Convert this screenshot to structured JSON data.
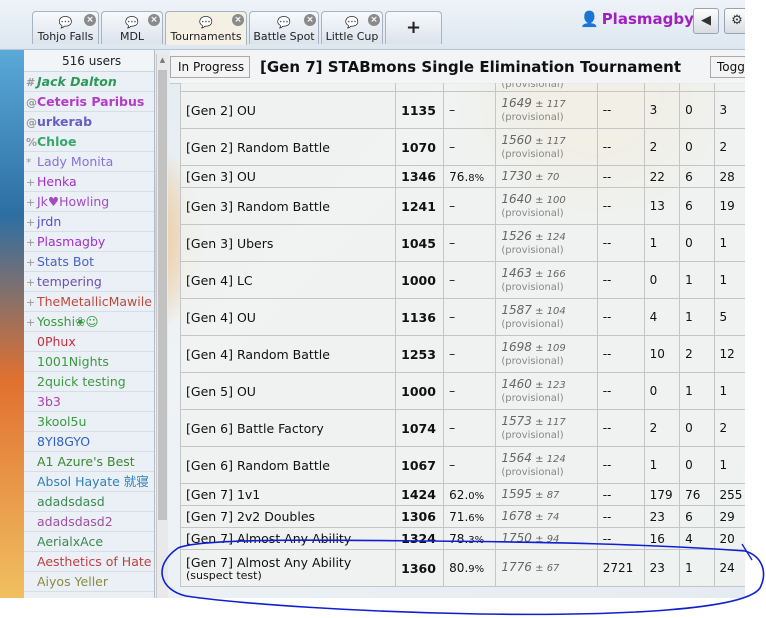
{
  "tabs": [
    {
      "label": "Tohjo Falls",
      "icon": "chat-bubbles-icon"
    },
    {
      "label": "MDL",
      "icon": "chat-bubble-icon"
    },
    {
      "label": "Tournaments",
      "icon": "chat-bubbles-icon"
    },
    {
      "label": "Battle Spot",
      "icon": "chat-bubble-icon"
    },
    {
      "label": "Little Cup",
      "icon": "chat-bubbles-icon"
    }
  ],
  "new_tab_label": "+",
  "user": {
    "name": "Plasmagby",
    "icon": "user-icon"
  },
  "header_buttons": {
    "sound": "speaker-icon",
    "settings": "gear-icon"
  },
  "userlist": {
    "count_label": "516 users",
    "users": [
      {
        "rank": "#",
        "name": "Jack Dalton",
        "color": "#2a9a55",
        "style": "bold italic"
      },
      {
        "rank": "@",
        "name": "Ceteris Paribus",
        "color": "#b23cc8",
        "style": "bold"
      },
      {
        "rank": "@",
        "name": "urkerab",
        "color": "#6b5cc4",
        "style": "bold"
      },
      {
        "rank": "%",
        "name": "Chloe",
        "color": "#36a86a",
        "style": "bold"
      },
      {
        "rank": "*",
        "name": "Lady Monita",
        "color": "#8a6fd8",
        "style": ""
      },
      {
        "rank": "+",
        "name": "Henka",
        "color": "#a230c8",
        "style": ""
      },
      {
        "rank": "+",
        "name": "Jk♥Howling",
        "color": "#a34cc0",
        "style": ""
      },
      {
        "rank": "+",
        "name": "jrdn",
        "color": "#5a4cc8",
        "style": ""
      },
      {
        "rank": "+",
        "name": "Plasmagby",
        "color": "#a230c8",
        "style": ""
      },
      {
        "rank": "+",
        "name": "Stats Bot",
        "color": "#4a62c8",
        "style": ""
      },
      {
        "rank": "+",
        "name": "tempering",
        "color": "#6a50b0",
        "style": ""
      },
      {
        "rank": "+",
        "name": "TheMetallicMawile",
        "color": "#c04a3a",
        "style": ""
      },
      {
        "rank": "+",
        "name": "Yosshi❀☺",
        "color": "#3a9a40",
        "style": ""
      },
      {
        "rank": "",
        "name": "0Phux",
        "color": "#c03040",
        "style": ""
      },
      {
        "rank": "",
        "name": "1001Nights",
        "color": "#3a9a40",
        "style": ""
      },
      {
        "rank": "",
        "name": "2quick testing",
        "color": "#3a9a40",
        "style": ""
      },
      {
        "rank": "",
        "name": "3b3",
        "color": "#b040b0",
        "style": ""
      },
      {
        "rank": "",
        "name": "3kool5u",
        "color": "#3a9a40",
        "style": ""
      },
      {
        "rank": "",
        "name": "8YI8GYO",
        "color": "#3060c8",
        "style": ""
      },
      {
        "rank": "",
        "name": "A1 Azure's Best",
        "color": "#3a8a30",
        "style": ""
      },
      {
        "rank": "",
        "name": "Absol Hayate 就寝",
        "color": "#3080b8",
        "style": ""
      },
      {
        "rank": "",
        "name": "adadsdasd",
        "color": "#3a8a50",
        "style": ""
      },
      {
        "rank": "",
        "name": "adadsdasd2",
        "color": "#a050a0",
        "style": ""
      },
      {
        "rank": "",
        "name": "AerialxAce",
        "color": "#3a8a50",
        "style": ""
      },
      {
        "rank": "",
        "name": "Aesthetics of Hate",
        "color": "#c04040",
        "style": ""
      },
      {
        "rank": "",
        "name": "Aiyos Yeller",
        "color": "#8a8a40",
        "style": ""
      }
    ]
  },
  "main": {
    "in_progress_label": "In Progress",
    "title": "[Gen 7] STABmons Single Elimination Tournament",
    "toggle_label": "Toggle"
  },
  "ladder": {
    "rows": [
      {
        "format": "[Gen 2] OU",
        "format_sub": "",
        "elo": "1135",
        "gxe": "–",
        "gxe_dec": "",
        "glicko": "1649",
        "glicko_dev": "117",
        "provisional": "(provisional)",
        "coil": "--",
        "w": "3",
        "l": "0",
        "t": "3"
      },
      {
        "format": "[Gen 2] Random Battle",
        "format_sub": "",
        "elo": "1070",
        "gxe": "–",
        "gxe_dec": "",
        "glicko": "1560",
        "glicko_dev": "117",
        "provisional": "(provisional)",
        "coil": "--",
        "w": "2",
        "l": "0",
        "t": "2"
      },
      {
        "format": "[Gen 3] OU",
        "format_sub": "",
        "elo": "1346",
        "gxe": "76.",
        "gxe_dec": "8%",
        "glicko": "1730",
        "glicko_dev": "70",
        "provisional": "",
        "coil": "--",
        "w": "22",
        "l": "6",
        "t": "28"
      },
      {
        "format": "[Gen 3] Random Battle",
        "format_sub": "",
        "elo": "1241",
        "gxe": "–",
        "gxe_dec": "",
        "glicko": "1640",
        "glicko_dev": "100",
        "provisional": "(provisional)",
        "coil": "--",
        "w": "13",
        "l": "6",
        "t": "19"
      },
      {
        "format": "[Gen 3] Ubers",
        "format_sub": "",
        "elo": "1045",
        "gxe": "–",
        "gxe_dec": "",
        "glicko": "1526",
        "glicko_dev": "124",
        "provisional": "(provisional)",
        "coil": "--",
        "w": "1",
        "l": "0",
        "t": "1"
      },
      {
        "format": "[Gen 4] LC",
        "format_sub": "",
        "elo": "1000",
        "gxe": "–",
        "gxe_dec": "",
        "glicko": "1463",
        "glicko_dev": "166",
        "provisional": "(provisional)",
        "coil": "--",
        "w": "0",
        "l": "1",
        "t": "1"
      },
      {
        "format": "[Gen 4] OU",
        "format_sub": "",
        "elo": "1136",
        "gxe": "–",
        "gxe_dec": "",
        "glicko": "1587",
        "glicko_dev": "104",
        "provisional": "(provisional)",
        "coil": "--",
        "w": "4",
        "l": "1",
        "t": "5"
      },
      {
        "format": "[Gen 4] Random Battle",
        "format_sub": "",
        "elo": "1253",
        "gxe": "–",
        "gxe_dec": "",
        "glicko": "1698",
        "glicko_dev": "109",
        "provisional": "(provisional)",
        "coil": "--",
        "w": "10",
        "l": "2",
        "t": "12"
      },
      {
        "format": "[Gen 5] OU",
        "format_sub": "",
        "elo": "1000",
        "gxe": "–",
        "gxe_dec": "",
        "glicko": "1460",
        "glicko_dev": "123",
        "provisional": "(provisional)",
        "coil": "--",
        "w": "0",
        "l": "1",
        "t": "1"
      },
      {
        "format": "[Gen 6] Battle Factory",
        "format_sub": "",
        "elo": "1074",
        "gxe": "–",
        "gxe_dec": "",
        "glicko": "1573",
        "glicko_dev": "117",
        "provisional": "(provisional)",
        "coil": "--",
        "w": "2",
        "l": "0",
        "t": "2"
      },
      {
        "format": "[Gen 6] Random Battle",
        "format_sub": "",
        "elo": "1067",
        "gxe": "–",
        "gxe_dec": "",
        "glicko": "1564",
        "glicko_dev": "124",
        "provisional": "(provisional)",
        "coil": "--",
        "w": "1",
        "l": "0",
        "t": "1"
      },
      {
        "format": "[Gen 7] 1v1",
        "format_sub": "",
        "elo": "1424",
        "gxe": "62.",
        "gxe_dec": "0%",
        "glicko": "1595",
        "glicko_dev": "87",
        "provisional": "",
        "coil": "--",
        "w": "179",
        "l": "76",
        "t": "255"
      },
      {
        "format": "[Gen 7] 2v2 Doubles",
        "format_sub": "",
        "elo": "1306",
        "gxe": "71.",
        "gxe_dec": "6%",
        "glicko": "1678",
        "glicko_dev": "74",
        "provisional": "",
        "coil": "--",
        "w": "23",
        "l": "6",
        "t": "29"
      },
      {
        "format": "[Gen 7] Almost Any Ability",
        "format_sub": "",
        "elo": "1324",
        "gxe": "78.",
        "gxe_dec": "3%",
        "glicko": "1750",
        "glicko_dev": "94",
        "provisional": "",
        "coil": "--",
        "w": "16",
        "l": "4",
        "t": "20"
      },
      {
        "format": "[Gen 7] Almost Any Ability",
        "format_sub": "(suspect test)",
        "elo": "1360",
        "gxe": "80.",
        "gxe_dec": "9%",
        "glicko": "1776",
        "glicko_dev": "67",
        "provisional": "",
        "coil": "2721",
        "w": "23",
        "l": "1",
        "t": "24"
      }
    ],
    "partial_top_provisional": "(provisional)"
  },
  "annotation_color": "#1020d0"
}
